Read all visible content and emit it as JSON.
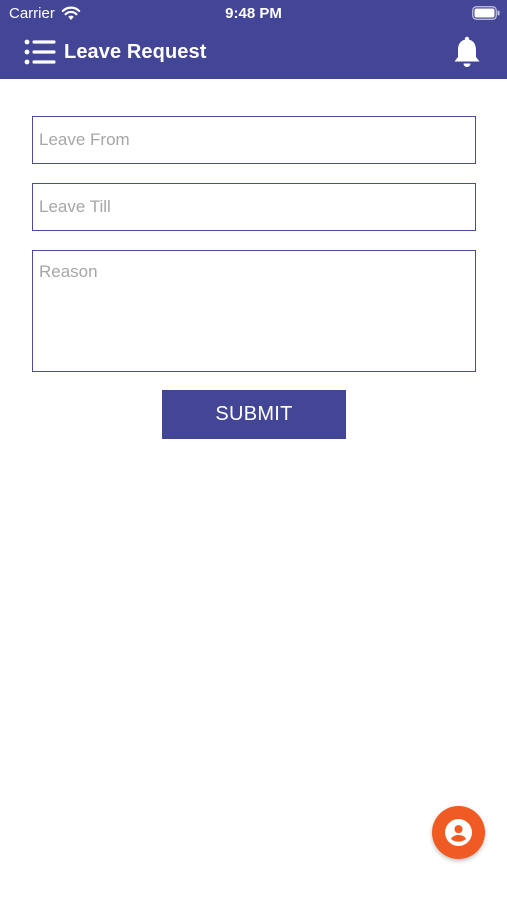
{
  "status_bar": {
    "carrier": "Carrier",
    "time": "9:48 PM"
  },
  "header": {
    "title": "Leave Request",
    "menu_icon": "menu-list-icon",
    "notification_icon": "bell-icon",
    "background_color": "#434596"
  },
  "form": {
    "leave_from": {
      "placeholder": "Leave From",
      "value": ""
    },
    "leave_till": {
      "placeholder": "Leave Till",
      "value": ""
    },
    "reason": {
      "placeholder": "Reason",
      "value": ""
    },
    "submit_label": "SUBMIT"
  },
  "fab": {
    "icon": "account-circle-icon",
    "color": "#f05b24"
  }
}
